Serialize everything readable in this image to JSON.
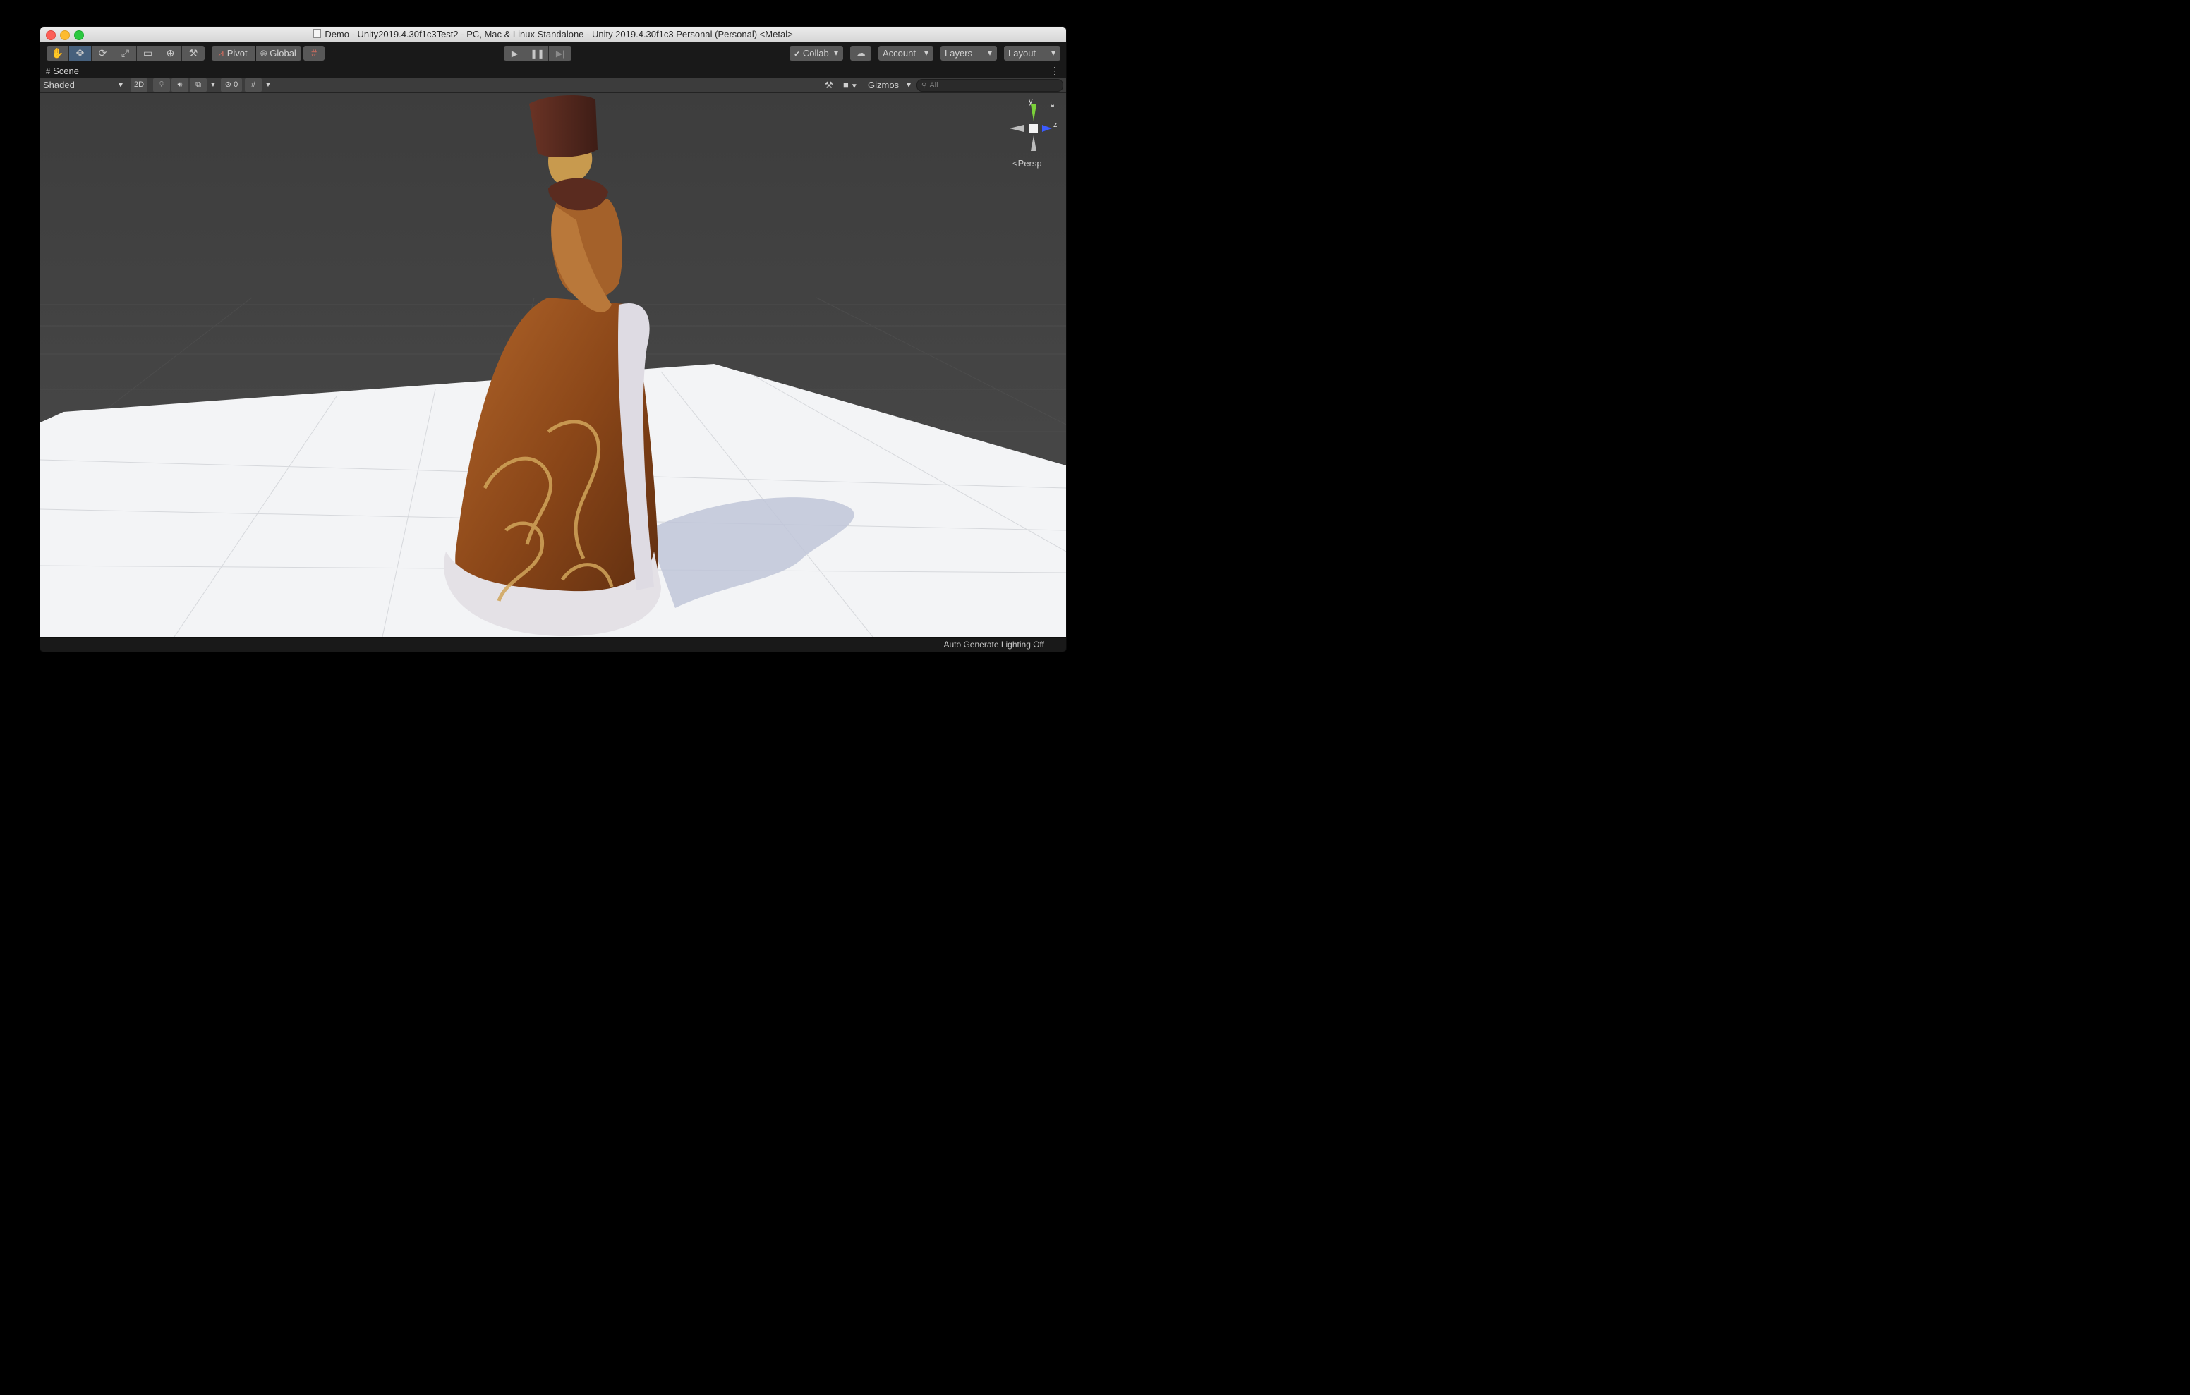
{
  "window": {
    "title": "Demo - Unity2019.4.30f1c3Test2 - PC, Mac & Linux Standalone - Unity 2019.4.30f1c3 Personal (Personal) <Metal>"
  },
  "toolbar": {
    "tools": [
      "hand-tool",
      "move-tool",
      "rotate-tool",
      "scale-tool",
      "rect-tool",
      "transform-tool",
      "custom-editor-tool"
    ],
    "active_tool": "move-tool",
    "pivot_label": "Pivot",
    "global_label": "Global",
    "collab_label": "Collab",
    "account_label": "Account",
    "layers_label": "Layers",
    "layout_label": "Layout"
  },
  "scene_tab": {
    "label": "Scene"
  },
  "scene_toolbar": {
    "draw_mode": "Shaded",
    "mode_2d_label": "2D",
    "hidden_count": "0",
    "gizmos_label": "Gizmos",
    "search_placeholder": "All"
  },
  "scene_gizmo": {
    "y_label": "y",
    "z_label": "z",
    "projection_label": "Persp"
  },
  "status": {
    "lighting_text": "Auto Generate Lighting Off"
  },
  "colors": {
    "accent": "#46607c",
    "window_bg": "#191919",
    "scene_sky": "#474747",
    "ground": "#f4f5f7",
    "gizmo_y": "#7bd13a",
    "gizmo_z": "#3b5bff"
  }
}
